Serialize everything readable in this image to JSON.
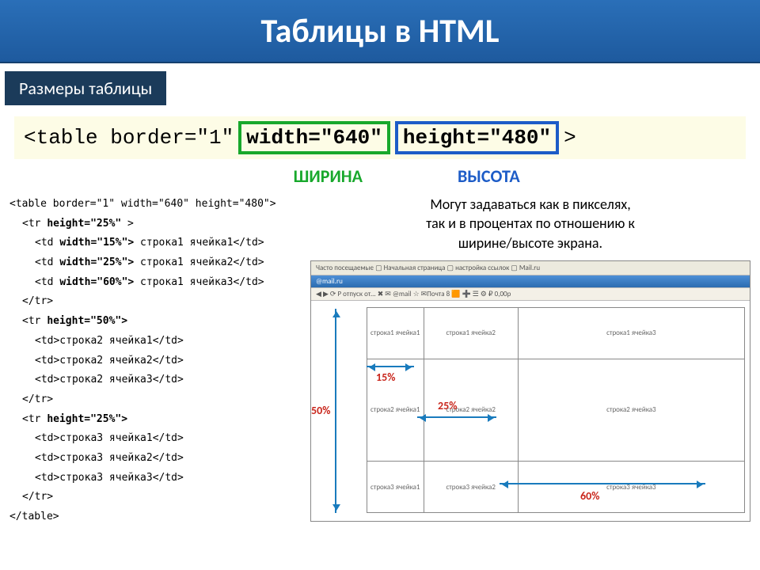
{
  "title": "Таблицы в HTML",
  "subtitle": "Размеры таблицы",
  "attr_line": {
    "prefix": "<table border=\"1\"",
    "width_attr": "width=\"640\"",
    "height_attr": "height=\"480\"",
    "suffix": ">"
  },
  "labels": {
    "width": "ШИРИНА",
    "height": "ВЫСОТА"
  },
  "description": "Могут задаваться как в пикселях,\nтак и в процентах по отношению к\nширине/высоте экрана.",
  "code": [
    {
      "t": "<table border=\"1\" width=\"640\" height=\"480\">",
      "i": 0
    },
    {
      "t": "<tr height=\"25%\" >",
      "i": 1,
      "b": "height=\"25%\""
    },
    {
      "t": "<td width=\"15%\"> строка1 ячейка1</td>",
      "i": 2,
      "b": "width=\"15%\">"
    },
    {
      "t": "<td width=\"25%\"> строка1 ячейка2</td>",
      "i": 2,
      "b": "width=\"25%\">"
    },
    {
      "t": "<td width=\"60%\"> строка1 ячейка3</td>",
      "i": 2,
      "b": "width=\"60%\">"
    },
    {
      "t": "</tr>",
      "i": 1
    },
    {
      "t": "<tr height=\"50%\">",
      "i": 1,
      "b": "height=\"50%\">"
    },
    {
      "t": "<td>строка2 ячейка1</td>",
      "i": 2
    },
    {
      "t": "<td>строка2 ячейка2</td>",
      "i": 2
    },
    {
      "t": "<td>строка2 ячейка3</td>",
      "i": 2
    },
    {
      "t": "</tr>",
      "i": 1
    },
    {
      "t": "<tr height=\"25%\">",
      "i": 1,
      "b": "height=\"25%\">"
    },
    {
      "t": "<td>строка3 ячейка1</td>",
      "i": 2
    },
    {
      "t": "<td>строка3 ячейка2</td>",
      "i": 2
    },
    {
      "t": "<td>строка3 ячейка3</td>",
      "i": 2
    },
    {
      "t": "</tr>",
      "i": 1
    },
    {
      "t": "</table>",
      "i": 0
    }
  ],
  "browser": {
    "top": "Часто посещаемые  ▢ Начальная страница  ▢  настройка ссылок  ▢ Mail.ru",
    "bar": "@mail.ru",
    "bar2": "◀ ▶  ⟳  Р отпуск от...   ✖   ✉ @mail   ☆   ✉Почта 8  🟧  ➕  ☰  ⚙  ₽ 0,00р"
  },
  "demo_cells": {
    "r1c1": "строка1 ячейка1",
    "r1c2": "строка1 ячейка2",
    "r1c3": "строка1 ячейка3",
    "r2c1": "строка2 ячейка1",
    "r2c2": "строка2 ячейка2",
    "r2c3": "строка2 ячейка3",
    "r3c1": "строка3 ячейка1",
    "r3c2": "строка3 ячейка2",
    "r3c3": "строка3 ячейка3"
  },
  "dims": {
    "w15": "15%",
    "w25": "25%",
    "w60": "60%",
    "h50": "50%"
  }
}
